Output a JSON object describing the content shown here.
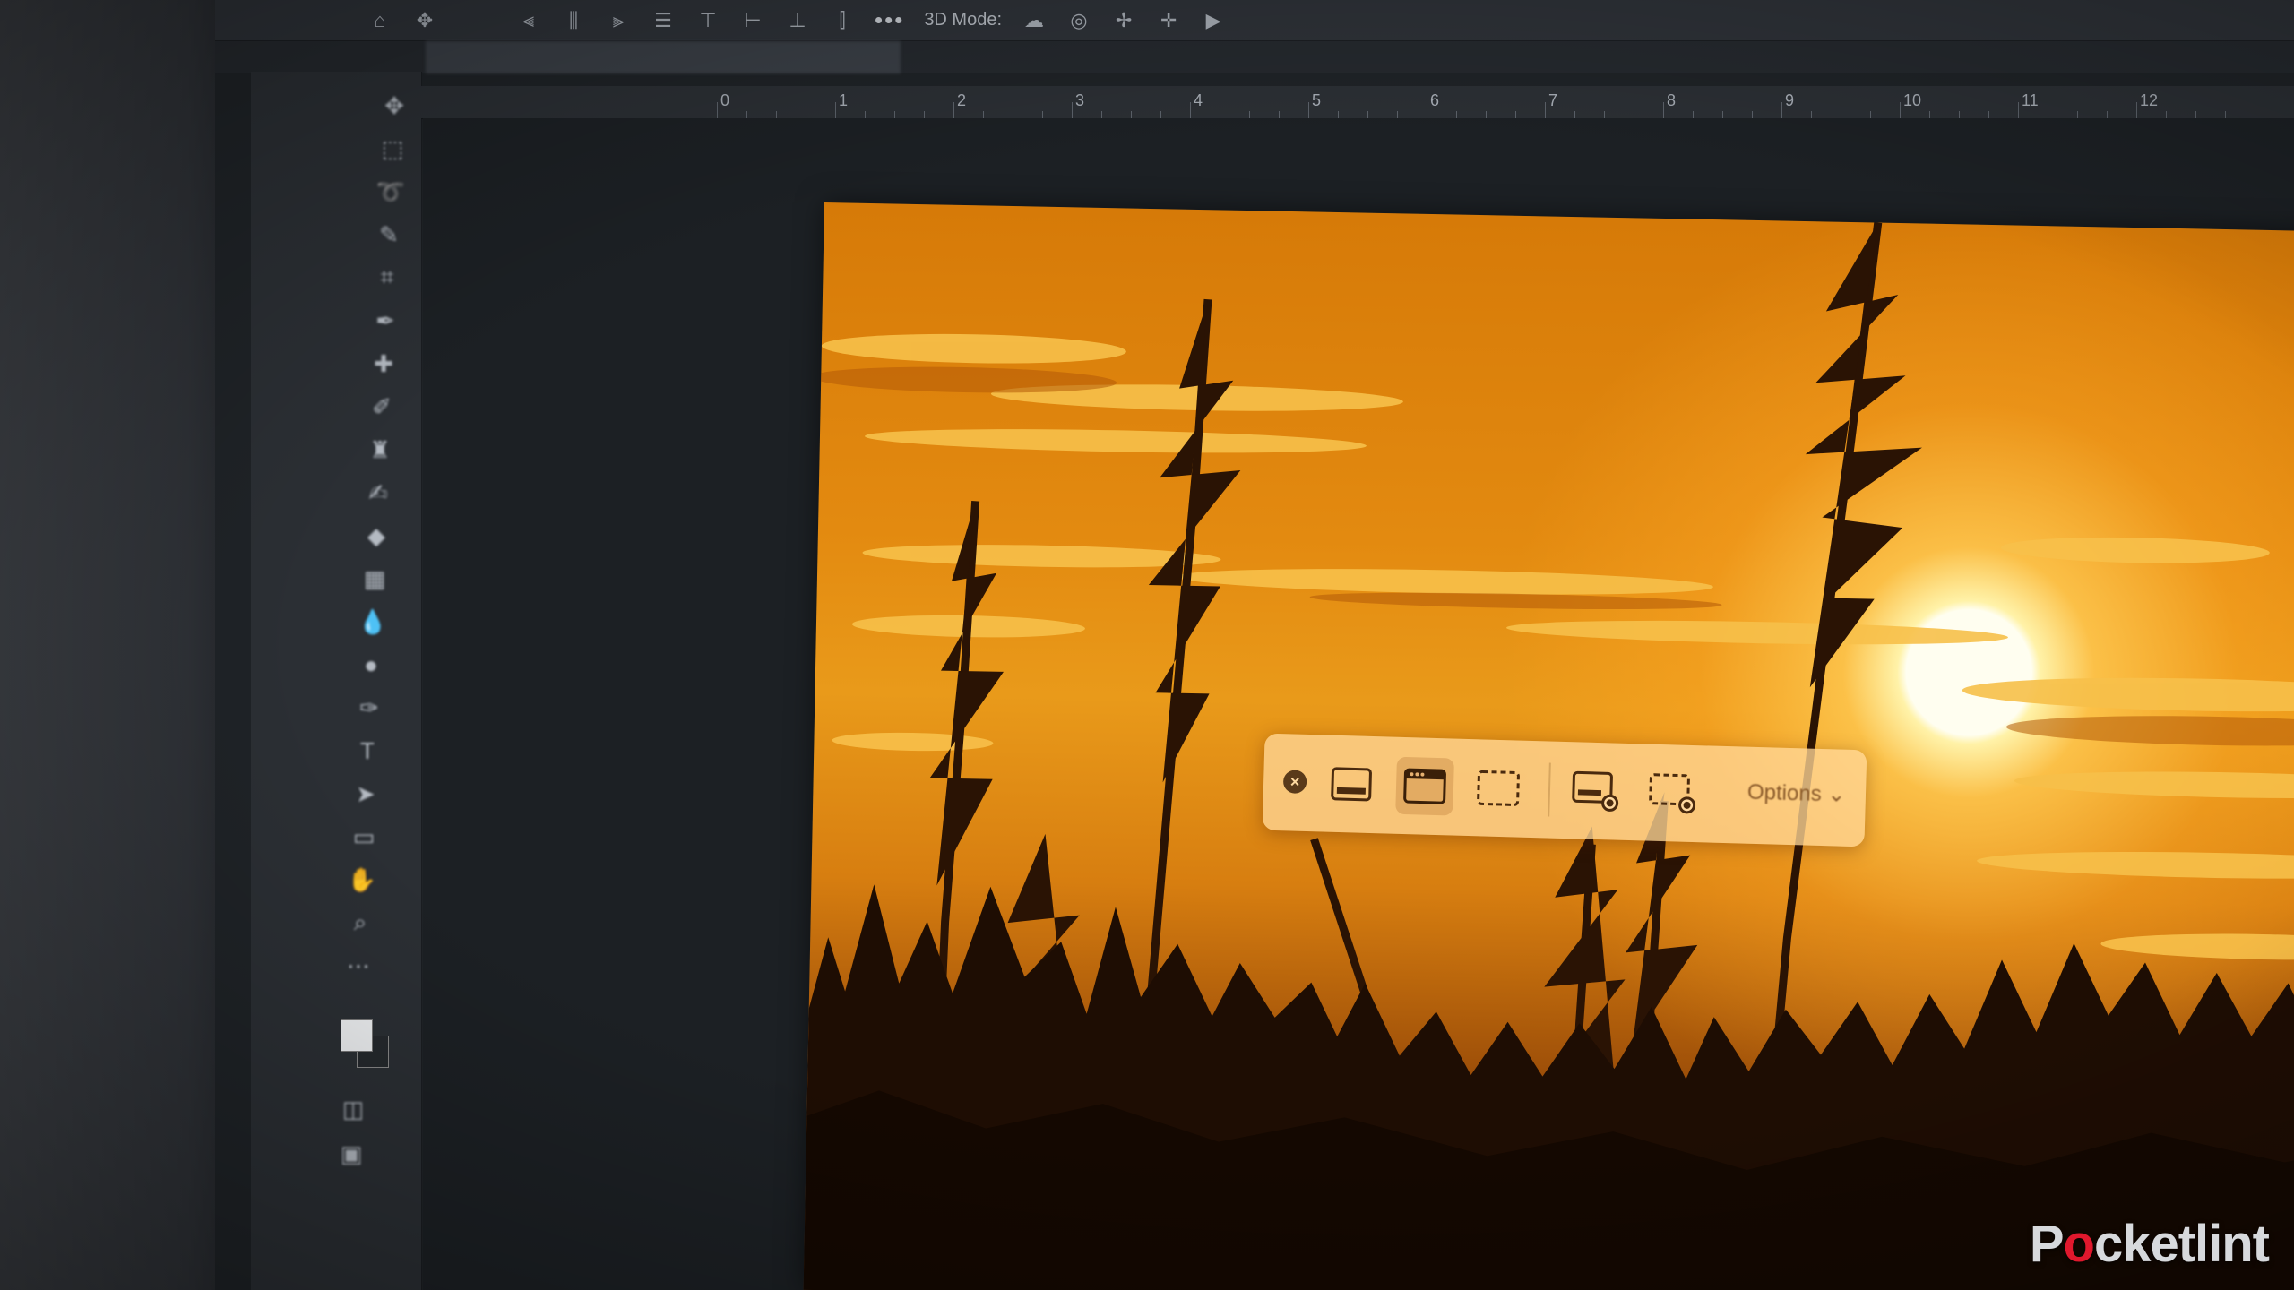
{
  "options_bar": {
    "mode_label": "3D Mode:",
    "more_label": "•••",
    "blurred_items": [
      "",
      "",
      ""
    ]
  },
  "document_tab": {
    "title": ""
  },
  "ruler": {
    "numbers": [
      "0",
      "1",
      "2",
      "3",
      "4",
      "5",
      "6",
      "7",
      "8",
      "9",
      "10",
      "11",
      "12"
    ]
  },
  "screenshot_toolbar": {
    "close_icon": "close-icon",
    "buttons": [
      {
        "name": "capture-entire-screen",
        "icon": "screen-icon"
      },
      {
        "name": "capture-selected-window",
        "icon": "window-icon",
        "active": true
      },
      {
        "name": "capture-selected-portion",
        "icon": "selection-icon"
      },
      {
        "name": "record-entire-screen",
        "icon": "record-screen-icon"
      },
      {
        "name": "record-selected-portion",
        "icon": "record-selection-icon"
      }
    ],
    "options_label": "Options",
    "options_chevron": "⌄"
  },
  "watermark": {
    "before": "P",
    "o": "o",
    "after": "cketlint"
  },
  "colors": {
    "sky_top": "#d67a08",
    "sky_mid": "#e99a1a",
    "ground": "#4a2106",
    "sun": "#fffef0",
    "toolbar_bg": "#2b2f34",
    "brand_red": "#e0182d"
  }
}
